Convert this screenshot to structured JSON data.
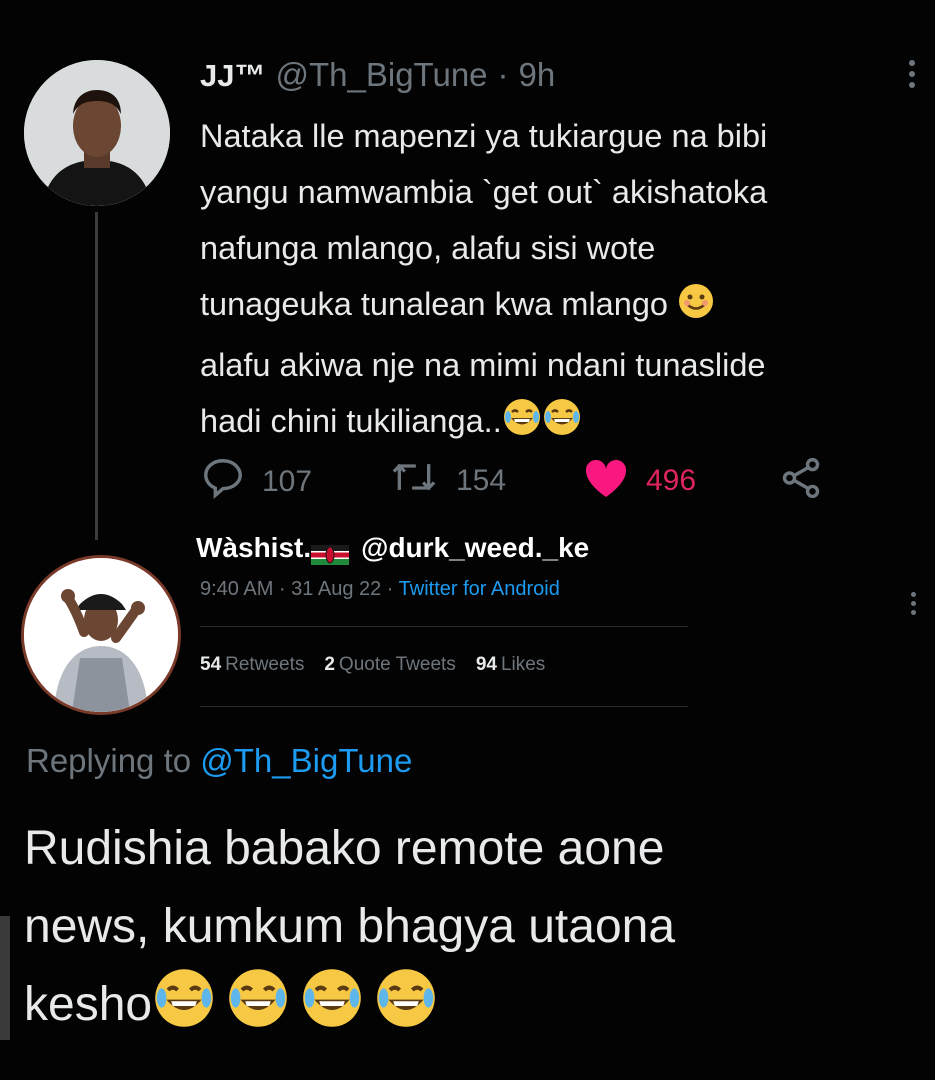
{
  "tweet": {
    "display_name": "JJ™",
    "handle": "@Th_BigTune",
    "separator": "·",
    "time": "9h",
    "text_lines": [
      "Nataka lle mapenzi  ya tukiargue na bibi",
      "yangu namwambia `get out` akishatoka",
      "nafunga mlango, alafu sisi wote",
      "tunageuka tunalean kwa mlango",
      "alafu akiwa nje na mimi ndani tunaslide",
      "hadi chini tukilianga.."
    ],
    "actions": {
      "replies": "107",
      "retweets": "154",
      "likes": "496"
    },
    "icons": [
      "reply-icon",
      "retweet-icon",
      "heart-icon",
      "share-icon",
      "more-icon"
    ]
  },
  "reply_tweet": {
    "display_name": "Wàshist.",
    "handle": "@durk_weed._ke",
    "timestamp": "9:40 AM · 31 Aug 22 · ",
    "source": "Twitter for Android",
    "stats": {
      "retweets_count": "54",
      "retweets_label": "Retweets",
      "quotes_count": "2",
      "quotes_label": "Quote Tweets",
      "likes_count": "94",
      "likes_label": "Likes"
    }
  },
  "reply": {
    "replying_prefix": "Replying to ",
    "replying_to": "@Th_BigTune",
    "text_lines": [
      "Rudishia babako remote aone",
      "news, kumkum bhagya utaona",
      "kesho"
    ]
  },
  "colors": {
    "background": "#030303",
    "text": "#e7e9ea",
    "muted": "#6e767d",
    "accent": "#1d9bf0",
    "like": "#e0245e"
  }
}
